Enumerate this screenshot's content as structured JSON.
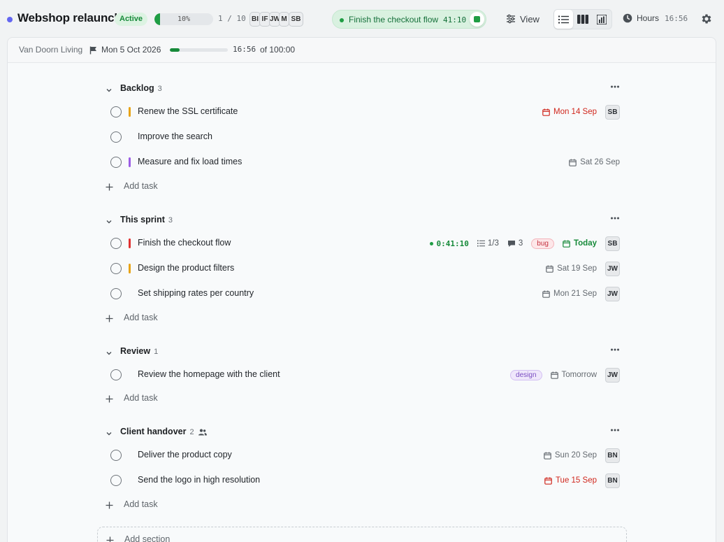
{
  "project": {
    "title": "Webshop relaunch",
    "status": "Active",
    "progress_label": "10%",
    "progress_fraction": 0.1,
    "task_count": "1 / 10",
    "members": [
      "BI",
      "IF",
      "JW",
      "M",
      "SB"
    ],
    "accent_color": "#6366f1"
  },
  "timer": {
    "task": "Finish the checkout flow",
    "elapsed": "41:10",
    "stop_icon": "stop-icon"
  },
  "toolbar": {
    "view_label": "View",
    "view_modes": [
      "list-view-icon",
      "board-view-icon",
      "chart-view-icon"
    ],
    "active_view": "list-view-icon",
    "hours_label": "Hours",
    "hours_value": "16:56",
    "settings_icon": "gear-icon"
  },
  "subbar": {
    "client": "Van Doorn Living",
    "due_date": "Mon 5 Oct 2026",
    "budget_used": "16:56",
    "budget_total": "of 100:00",
    "budget_fraction": 0.17
  },
  "sections": [
    {
      "name": "Backlog",
      "count": "3",
      "tasks": [
        {
          "title": "Renew the SSL certificate",
          "priority": "#e8a317",
          "date": "Mon 14 Sep",
          "date_state": "overdue",
          "assignee": "SB"
        },
        {
          "title": "Improve the search",
          "priority": null
        },
        {
          "title": "Measure and fix load times",
          "priority": "#9b5de5",
          "date": "Sat 26 Sep",
          "date_state": "normal"
        }
      ],
      "add_label": "Add task"
    },
    {
      "name": "This sprint",
      "count": "3",
      "tasks": [
        {
          "title": "Finish the checkout flow",
          "priority": "#e03131",
          "running_timer": "0:41:10",
          "subtasks": "1/3",
          "comments": "3",
          "tag": "bug",
          "date": "Today",
          "date_state": "today",
          "assignee": "SB"
        },
        {
          "title": "Design the product filters",
          "priority": "#e8a317",
          "date": "Sat 19 Sep",
          "date_state": "normal",
          "assignee": "JW"
        },
        {
          "title": "Set shipping rates per country",
          "priority": null,
          "date": "Mon 21 Sep",
          "date_state": "normal",
          "assignee": "JW"
        }
      ],
      "add_label": "Add task"
    },
    {
      "name": "Review",
      "count": "1",
      "tasks": [
        {
          "title": "Review the homepage with the client",
          "priority": null,
          "tag": "design",
          "date": "Tomorrow",
          "date_state": "normal",
          "assignee": "JW"
        }
      ],
      "add_label": "Add task"
    },
    {
      "name": "Client handover",
      "count": "2",
      "shared": true,
      "tasks": [
        {
          "title": "Deliver the product copy",
          "priority": null,
          "date": "Sun 20 Sep",
          "date_state": "normal",
          "assignee": "BN"
        },
        {
          "title": "Send the logo in high resolution",
          "priority": null,
          "date": "Tue 15 Sep",
          "date_state": "overdue",
          "assignee": "BN"
        }
      ],
      "add_label": "Add task"
    }
  ],
  "add_section_label": "Add section"
}
